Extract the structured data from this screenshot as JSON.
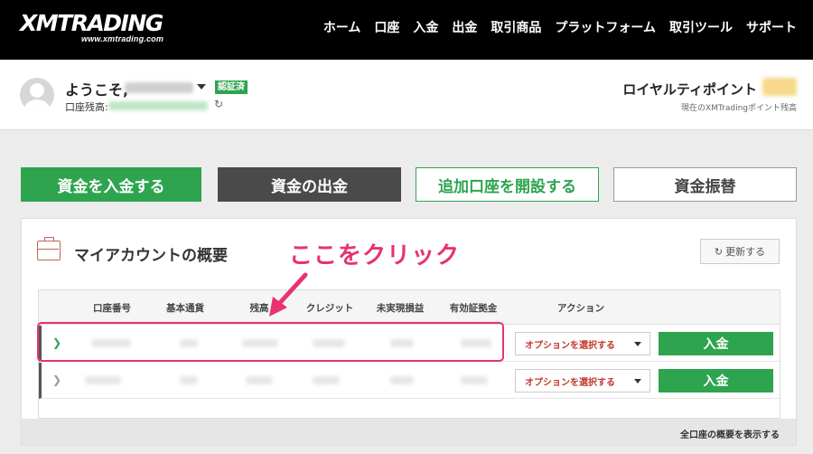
{
  "header": {
    "logo_text": "XMTRADING",
    "logo_sub": "www.xmtrading.com",
    "nav": [
      "ホーム",
      "口座",
      "入金",
      "出金",
      "取引商品",
      "プラットフォーム",
      "取引ツール",
      "サポート"
    ]
  },
  "welcome": {
    "greeting": "ようこそ,",
    "verified_badge": "認証済",
    "balance_label": "口座残高:",
    "points_title": "ロイヤルティポイント",
    "points_sub": "現在のXMTradingポイント残高"
  },
  "actions": {
    "deposit": "資金を入金する",
    "withdraw": "資金の出金",
    "open_account": "追加口座を開設する",
    "transfer": "資金振替"
  },
  "overview": {
    "title": "マイアカウントの概要",
    "annotation": "ここをクリック",
    "refresh": "更新する",
    "columns": [
      "口座番号",
      "基本通貨",
      "残高",
      "クレジット",
      "未実現損益",
      "有効証拠金",
      "アクション"
    ],
    "rows": [
      {
        "select_label": "オプションを選択する",
        "deposit_label": "入金"
      },
      {
        "select_label": "オプションを選択する",
        "deposit_label": "入金"
      }
    ],
    "show_all": "全口座の概要を表示する"
  },
  "colors": {
    "green": "#2ea44f",
    "annotation": "#e8336d",
    "dark_button": "#4a4a4a"
  }
}
